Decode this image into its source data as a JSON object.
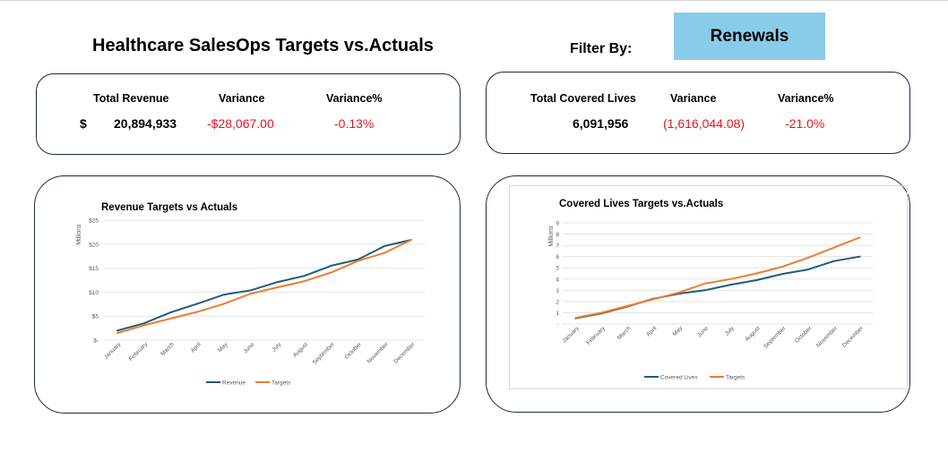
{
  "header": {
    "title": "Healthcare SalesOps Targets vs.Actuals",
    "filter_label": "Filter By:",
    "filter_value": "Renewals"
  },
  "kpi_revenue": {
    "h_total": "Total Revenue",
    "h_variance": "Variance",
    "h_variance_pct": "Variance%",
    "currency_symbol": "$",
    "total": "20,894,933",
    "variance": "-$28,067.00",
    "variance_pct": "-0.13%"
  },
  "kpi_lives": {
    "h_total": "Total Covered Lives",
    "h_variance": "Variance",
    "h_variance_pct": "Variance%",
    "total": "6,091,956",
    "variance": "(1,616,044.08)",
    "variance_pct": "-21.0%"
  },
  "colors": {
    "actual": "#1f5d7a",
    "target": "#ed7d31",
    "variance_red": "#e8141b",
    "filter_bg": "#89cce9"
  },
  "chart_data": [
    {
      "type": "line",
      "title": "Revenue  Targets vs Actuals",
      "ylabel": "Millions",
      "xlabel": "",
      "categories": [
        "January",
        "February",
        "March",
        "April",
        "May",
        "June",
        "July",
        "August",
        "September",
        "October",
        "November",
        "December"
      ],
      "ylim": [
        0,
        25
      ],
      "yticks": [
        0,
        5,
        10,
        15,
        20,
        25
      ],
      "ytick_labels": [
        "$-",
        "$5",
        "$10",
        "$15",
        "$20",
        "$25"
      ],
      "grid": true,
      "legend": "bottom",
      "series": [
        {
          "name": "Revenue",
          "values": [
            2.0,
            3.5,
            5.8,
            7.6,
            9.5,
            10.4,
            12.1,
            13.4,
            15.5,
            16.8,
            19.6,
            20.9
          ]
        },
        {
          "name": "Targets",
          "values": [
            1.5,
            3.1,
            4.5,
            5.9,
            7.6,
            9.7,
            11.0,
            12.3,
            14.1,
            16.5,
            18.2,
            20.9
          ]
        }
      ]
    },
    {
      "type": "line",
      "title": "Covered Lives  Targets vs.Actuals",
      "ylabel": "Millions",
      "xlabel": "",
      "categories": [
        "January",
        "February",
        "March",
        "April",
        "May",
        "June",
        "July",
        "August",
        "September",
        "October",
        "November",
        "December"
      ],
      "ylim": [
        0,
        9
      ],
      "yticks": [
        0,
        1,
        2,
        3,
        4,
        5,
        6,
        7,
        8,
        9
      ],
      "ytick_labels": [
        "-",
        "1",
        "2",
        "3",
        "4",
        "5",
        "6",
        "7",
        "8",
        "9"
      ],
      "grid": true,
      "legend": "bottom",
      "series": [
        {
          "name": "Covered Lives",
          "values": [
            0.5,
            0.95,
            1.55,
            2.25,
            2.7,
            3.0,
            3.5,
            3.9,
            4.45,
            4.85,
            5.6,
            6.0
          ]
        },
        {
          "name": "Targets",
          "values": [
            0.55,
            1.0,
            1.6,
            2.2,
            2.8,
            3.6,
            4.0,
            4.5,
            5.1,
            5.9,
            6.8,
            7.7
          ]
        }
      ]
    }
  ]
}
